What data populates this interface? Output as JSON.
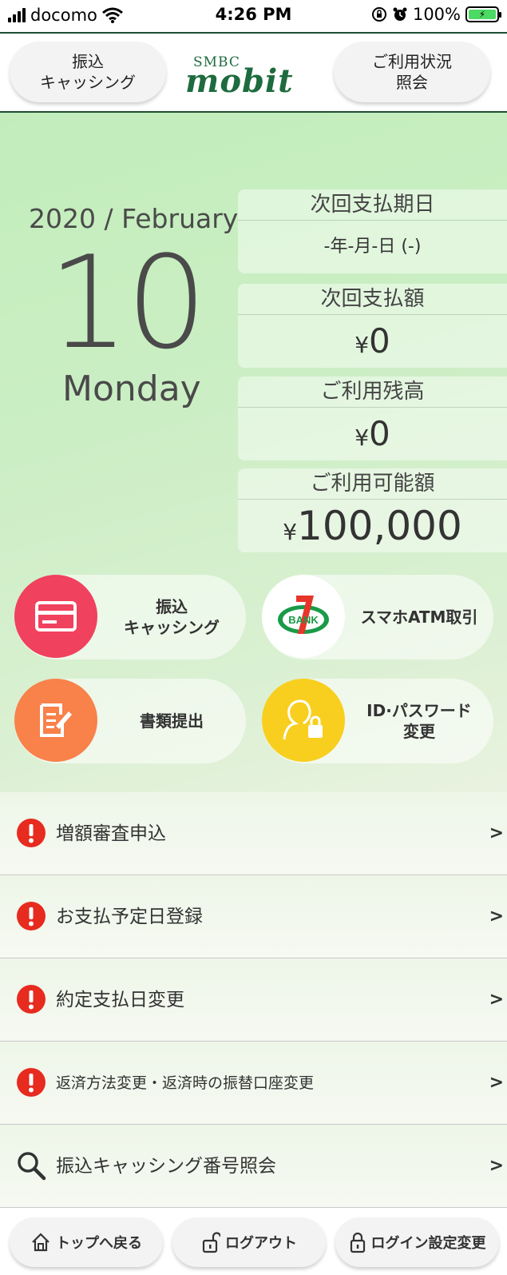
{
  "status_bar": {
    "carrier": "docomo",
    "time": "4:26 PM",
    "battery": "100%"
  },
  "header": {
    "left_button": "振込\nキャッシング",
    "logo_top": "SMBC",
    "logo_main": "mobit",
    "right_button": "ご利用状況\n照会"
  },
  "date": {
    "year_month": "2020 / February",
    "day": "10",
    "weekday": "Monday"
  },
  "info": [
    {
      "label": "次回支払期日",
      "value": "-年-月-日 (-)"
    },
    {
      "label": "次回支払額",
      "currency": "¥",
      "value": "0"
    },
    {
      "label": "ご利用残高",
      "currency": "¥",
      "value": "0"
    },
    {
      "label": "ご利用可能額",
      "currency": "¥",
      "value": "100,000"
    }
  ],
  "actions": [
    {
      "label": "振込\nキャッシング",
      "icon": "card-icon",
      "color": "#f0415e"
    },
    {
      "label": "スマホATM取引",
      "icon": "seven-bank-icon",
      "badge": "BANK",
      "color": "#ffffff"
    },
    {
      "label": "書類提出",
      "icon": "document-icon",
      "color": "#f9814a"
    },
    {
      "label": "ID·パスワード\n変更",
      "icon": "user-lock-icon",
      "color": "#f8cf1e"
    }
  ],
  "menu": [
    {
      "label": "増額審査申込",
      "icon": "alert-icon",
      "chevron": ">"
    },
    {
      "label": "お支払予定日登録",
      "icon": "alert-icon",
      "chevron": ">"
    },
    {
      "label": "約定支払日変更",
      "icon": "alert-icon",
      "chevron": ">"
    },
    {
      "label": "返済方法変更・返済時の振替口座変更",
      "icon": "alert-icon",
      "chevron": ">"
    },
    {
      "label": "振込キャッシング番号照会",
      "icon": "search-icon",
      "chevron": ">"
    }
  ],
  "bottom_nav": [
    {
      "label": "トップへ戻る",
      "icon": "home-icon"
    },
    {
      "label": "ログアウト",
      "icon": "unlock-icon"
    },
    {
      "label": "ログイン設定変更",
      "icon": "lock-icon"
    }
  ]
}
